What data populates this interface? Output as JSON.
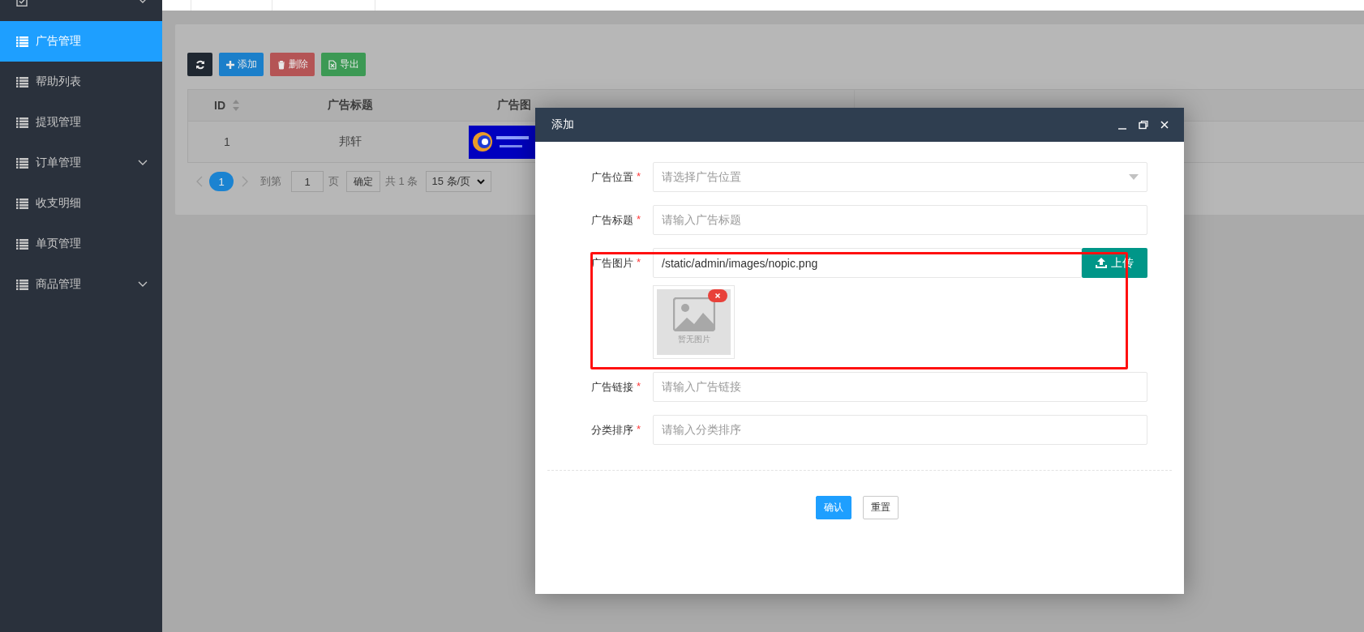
{
  "sidebar": {
    "items": [
      {
        "expandable": true,
        "selected": false
      },
      {
        "label": "广告管理",
        "expandable": false,
        "selected": true
      },
      {
        "label": "帮助列表",
        "expandable": false,
        "selected": false
      },
      {
        "label": "提现管理",
        "expandable": false,
        "selected": false
      },
      {
        "label": "订单管理",
        "expandable": true,
        "selected": false
      },
      {
        "label": "收支明细",
        "expandable": false,
        "selected": false
      },
      {
        "label": "单页管理",
        "expandable": false,
        "selected": false
      },
      {
        "label": "商品管理",
        "expandable": true,
        "selected": false
      }
    ]
  },
  "toolbar": {
    "buttons": [
      {
        "kind": "refresh"
      },
      {
        "kind": "add",
        "label": "添加"
      },
      {
        "kind": "delete",
        "label": "删除"
      },
      {
        "kind": "export",
        "label": "导出"
      }
    ]
  },
  "table": {
    "columns": [
      {
        "label": "ID",
        "sortable": true
      },
      {
        "label": "广告标题",
        "sortable": false
      },
      {
        "label": "广告图",
        "sortable": false
      }
    ],
    "rows": [
      {
        "cells": [
          {
            "kind": "text",
            "text": "1"
          },
          {
            "kind": "text",
            "text": "邦轩"
          },
          {
            "kind": "picture"
          }
        ]
      }
    ]
  },
  "pagination": {
    "pages": [
      {
        "label": "1",
        "selected": true
      }
    ],
    "goto_label": "到第",
    "goto_value": "1",
    "page_unit": "页",
    "confirm": "确定",
    "total": "共 1 条",
    "page_size": "15 条/页"
  },
  "modal": {
    "title": "添加",
    "fields": [
      {
        "kind": "select",
        "label": "广告位置",
        "required_mark": "*",
        "placeholder": "请选择广告位置"
      },
      {
        "kind": "text",
        "label": "广告标题",
        "required_mark": "*",
        "placeholder": "请输入广告标题"
      },
      {
        "kind": "upload",
        "label": "广告图片",
        "required_mark": "*",
        "value": "/static/admin/images/nopic.png",
        "button": "上传",
        "preview_caption": "暂无图片",
        "highlighted": true
      },
      {
        "kind": "text",
        "label": "广告链接",
        "required_mark": "*",
        "placeholder": "请输入广告链接"
      },
      {
        "kind": "text",
        "label": "分类排序",
        "required_mark": "*",
        "placeholder": "请输入分类排序"
      }
    ],
    "buttons": [
      {
        "kind": "primary",
        "label": "确认"
      },
      {
        "kind": "default",
        "label": "重置"
      }
    ]
  }
}
